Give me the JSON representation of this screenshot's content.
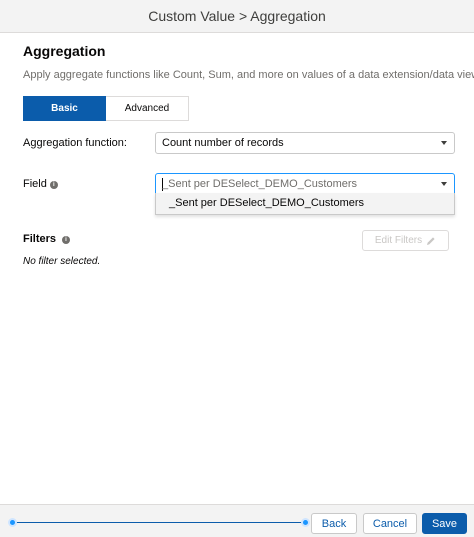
{
  "header": {
    "title": "Custom Value > Aggregation"
  },
  "section": {
    "title": "Aggregation",
    "description": "Apply aggregate functions like Count, Sum, and more on values of a data extension/data view."
  },
  "tabs": [
    {
      "label": "Basic",
      "active": true
    },
    {
      "label": "Advanced",
      "active": false
    }
  ],
  "aggregation_function": {
    "label": "Aggregation function:",
    "selected": "Count number of records"
  },
  "field": {
    "label": "Field",
    "placeholder": "_Sent per DESelect_DEMO_Customers",
    "options": [
      "_Sent per DESelect_DEMO_Customers"
    ]
  },
  "filters": {
    "label": "Filters",
    "edit_button": "Edit Filters",
    "empty_text": "No filter selected."
  },
  "footer": {
    "back_label": "Back",
    "cancel_label": "Cancel",
    "save_label": "Save"
  },
  "colors": {
    "brand": "#0b5cab",
    "accent": "#1b96ff",
    "header_bg": "#f3f3f3"
  },
  "icons": [
    "info-icon",
    "chevron-down-icon",
    "pencil-icon"
  ]
}
